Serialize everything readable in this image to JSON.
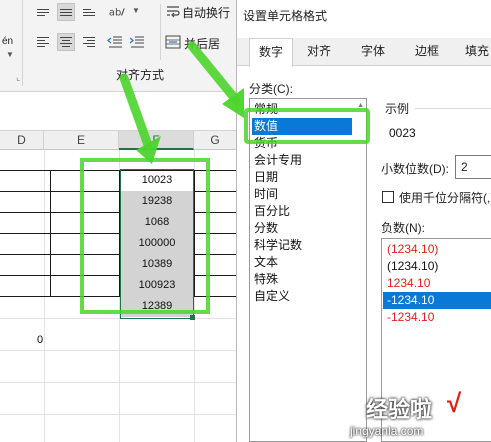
{
  "ribbon": {
    "wrap_text_label": "自动换行",
    "merge_label": "并后居",
    "alignment_group_label": "对齐方式",
    "font_group_partial": "én",
    "orientation_icon": "text-orientation-icon"
  },
  "sheet": {
    "columns": [
      "D",
      "E",
      "F",
      "G"
    ],
    "selected_column": "F",
    "values": [
      "10023",
      "19238",
      "1068",
      "100000",
      "10389",
      "100923",
      "12389"
    ],
    "stray_value": "0"
  },
  "dialog": {
    "title": "设置单元格格式",
    "tabs": [
      "数字",
      "对齐",
      "字体",
      "边框",
      "填充"
    ],
    "active_tab": "数字",
    "category_label": "分类(C):",
    "categories": [
      "常规",
      "数值",
      "货币",
      "会计专用",
      "日期",
      "时间",
      "百分比",
      "分数",
      "科学记数",
      "文本",
      "特殊",
      "自定义"
    ],
    "selected_category": "数值",
    "sample_label": "示例",
    "sample_value": "0023",
    "decimal_label": "小数位数(D):",
    "decimal_value": "2",
    "thousands_label": "使用千位分隔符(,)",
    "thousands_checked": false,
    "negative_label": "负数(N):",
    "negative_formats": [
      {
        "text": "(1234.10)",
        "color": "#e02020"
      },
      {
        "text": "(1234.10)",
        "color": "#111111"
      },
      {
        "text": "1234.10",
        "color": "#e02020"
      },
      {
        "text": "-1234.10",
        "color": "#ffffff"
      },
      {
        "text": "-1234.10",
        "color": "#e02020"
      }
    ],
    "selected_negative_index": 3
  },
  "annotation": {
    "highlight_color": "#4cd42c",
    "arrow_color": "#4cd42c"
  },
  "watermark": {
    "text": "经验啦",
    "check": "√",
    "url": "jingyanla.com"
  }
}
